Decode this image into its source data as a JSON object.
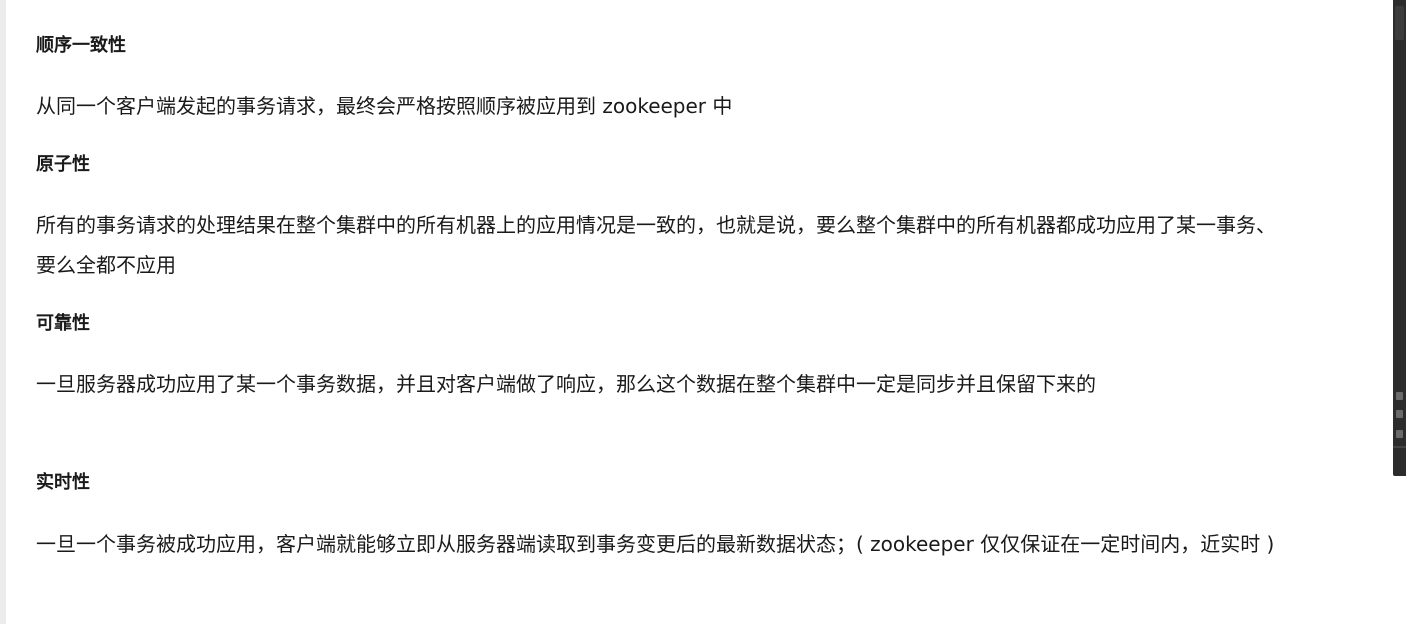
{
  "sections": [
    {
      "heading": "顺序一致性",
      "body_lines": [
        "从同一个客户端发起的事务请求，最终会严格按照顺序被应用到 zookeeper 中"
      ]
    },
    {
      "heading": "原子性",
      "body_lines": [
        "所有的事务请求的处理结果在整个集群中的所有机器上的应用情况是一致的，也就是说，要么整个集群中的所有机器都成功应用了某一事务、",
        "要么全都不应用"
      ]
    },
    {
      "heading": "可靠性",
      "body_lines": [
        "一旦服务器成功应用了某一个事务数据，并且对客户端做了响应，那么这个数据在整个集群中一定是同步并且保留下来的"
      ]
    },
    {
      "heading": "实时性",
      "body_lines": [
        "一旦一个事务被成功应用，客户端就能够立即从服务器端读取到事务变更后的最新数据状态；( zookeeper 仅仅保证在一定时间内，近实时 )"
      ]
    }
  ]
}
